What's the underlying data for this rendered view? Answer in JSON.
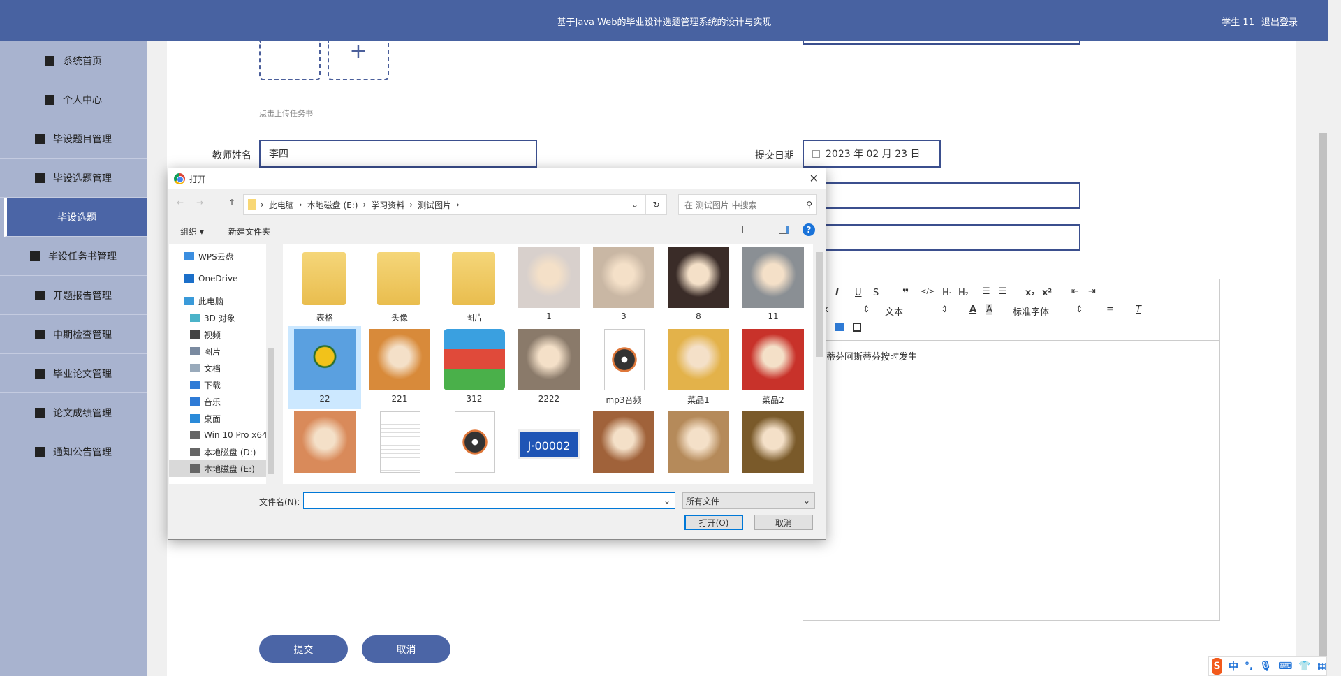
{
  "header": {
    "title": "基于Java Web的毕业设计选题管理系统的设计与实现",
    "user": "学生 11",
    "logout": "退出登录"
  },
  "sidebar": {
    "items": [
      {
        "label": "系统首页",
        "icon": "home-icon"
      },
      {
        "label": "个人中心",
        "icon": "user-icon"
      },
      {
        "label": "毕设题目管理",
        "icon": "grid-icon"
      },
      {
        "label": "毕设选题管理",
        "icon": "clipboard-icon"
      },
      {
        "label": "毕设选题",
        "icon": "",
        "active": true
      },
      {
        "label": "毕设任务书管理",
        "icon": "briefcase-icon"
      },
      {
        "label": "开题报告管理",
        "icon": "grid-icon"
      },
      {
        "label": "中期检查管理",
        "icon": "grid-icon"
      },
      {
        "label": "毕业论文管理",
        "icon": "grid-icon"
      },
      {
        "label": "论文成绩管理",
        "icon": "chart-icon"
      },
      {
        "label": "通知公告管理",
        "icon": "bar-chart-icon"
      }
    ]
  },
  "form": {
    "upload_hint": "点击上传任务书",
    "teacher_label": "教师姓名",
    "teacher_value": "李四",
    "date_label": "提交日期",
    "date_value": "2023 年 02 月 23 日",
    "editor_toolbar": {
      "size": "px",
      "text": "文本",
      "font": "标准字体"
    },
    "editor_content": "斯蒂芬阿斯蒂芬按时发生",
    "submit": "提交",
    "cancel": "取消"
  },
  "dialog": {
    "title": "打开",
    "breadcrumb": [
      "此电脑",
      "本地磁盘 (E:)",
      "学习资料",
      "测试图片"
    ],
    "search_placeholder": "在 测试图片 中搜索",
    "organize": "组织 ▾",
    "new_folder": "新建文件夹",
    "nav": [
      {
        "label": "WPS云盘",
        "icon": "cloud-icon",
        "indent": 1
      },
      {
        "label": "OneDrive",
        "icon": "onedrive-icon",
        "indent": 1
      },
      {
        "label": "此电脑",
        "icon": "computer-icon",
        "indent": 1
      },
      {
        "label": "3D 对象",
        "icon": "cube-icon",
        "indent": 2
      },
      {
        "label": "视频",
        "icon": "video-icon",
        "indent": 2
      },
      {
        "label": "图片",
        "icon": "picture-icon",
        "indent": 2
      },
      {
        "label": "文档",
        "icon": "document-icon",
        "indent": 2
      },
      {
        "label": "下载",
        "icon": "download-icon",
        "indent": 2
      },
      {
        "label": "音乐",
        "icon": "music-icon",
        "indent": 2
      },
      {
        "label": "桌面",
        "icon": "desktop-icon",
        "indent": 2
      },
      {
        "label": "Win 10 Pro x64",
        "icon": "drive-icon",
        "indent": 2
      },
      {
        "label": "本地磁盘 (D:)",
        "icon": "drive-icon",
        "indent": 2
      },
      {
        "label": "本地磁盘 (E:)",
        "icon": "drive-icon",
        "indent": 2,
        "selected": true
      }
    ],
    "files": [
      {
        "name": "表格",
        "kind": "folder"
      },
      {
        "name": "头像",
        "kind": "folder"
      },
      {
        "name": "图片",
        "kind": "folder"
      },
      {
        "name": "1",
        "kind": "photo",
        "color": "#d8d0cc"
      },
      {
        "name": "3",
        "kind": "photo",
        "color": "#c9b7a4"
      },
      {
        "name": "8",
        "kind": "photo",
        "color": "#3a2c28"
      },
      {
        "name": "11",
        "kind": "photo",
        "color": "#8a8f94"
      },
      {
        "name": "22",
        "kind": "photo",
        "color": "#4a90d9",
        "selected": true
      },
      {
        "name": "221",
        "kind": "photo",
        "color": "#d88a3a"
      },
      {
        "name": "312",
        "kind": "archive"
      },
      {
        "name": "2222",
        "kind": "photo",
        "color": "#8a7a6a"
      },
      {
        "name": "mp3音频",
        "kind": "audio"
      },
      {
        "name": "菜品1",
        "kind": "photo",
        "color": "#e3b24a"
      },
      {
        "name": "菜品2",
        "kind": "photo",
        "color": "#c8322a"
      },
      {
        "name": "",
        "kind": "photo",
        "color": "#d98a5a"
      },
      {
        "name": "",
        "kind": "doc"
      },
      {
        "name": "",
        "kind": "audio"
      },
      {
        "name": "",
        "kind": "plate",
        "plate": "J·00002"
      },
      {
        "name": "",
        "kind": "photo",
        "color": "#a0623a"
      },
      {
        "name": "",
        "kind": "photo",
        "color": "#b58a5a"
      },
      {
        "name": "",
        "kind": "photo",
        "color": "#7a5a2a"
      }
    ],
    "filename_label": "文件名(N):",
    "filename_value": "",
    "filetype": "所有文件",
    "open": "打开(O)",
    "cancel": "取消"
  },
  "ime": {
    "label": "中",
    "punct": "°,"
  }
}
